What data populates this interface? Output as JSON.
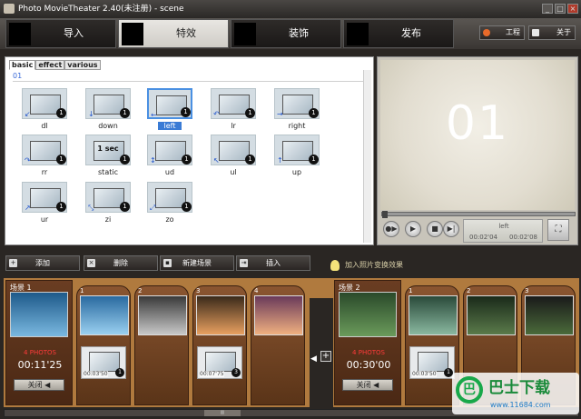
{
  "window": {
    "title": "Photo MovieTheater 2.40(未注册) - scene",
    "minimize": "_",
    "maximize": "□",
    "close": "×"
  },
  "tabs": [
    {
      "label": "导入",
      "active": false
    },
    {
      "label": "特效",
      "active": true
    },
    {
      "label": "装饰",
      "active": false
    },
    {
      "label": "发布",
      "active": false
    }
  ],
  "topbuttons": {
    "project": "工程",
    "about": "关于"
  },
  "effects_panel": {
    "subtabs": [
      "basic",
      "effect",
      "various"
    ],
    "group": "01",
    "items": [
      {
        "label": "dl",
        "badge": "1",
        "arrow": "↙"
      },
      {
        "label": "down",
        "badge": "1",
        "arrow": "↓"
      },
      {
        "label": "left",
        "badge": "1",
        "arrow": "←",
        "selected": true
      },
      {
        "label": "lr",
        "badge": "1",
        "arrow": "↶"
      },
      {
        "label": "right",
        "badge": "1",
        "arrow": "→"
      },
      {
        "label": "rr",
        "badge": "1",
        "arrow": "↷"
      },
      {
        "label": "static",
        "badge": "1",
        "text": "1 sec"
      },
      {
        "label": "ud",
        "badge": "1",
        "arrow": "↕"
      },
      {
        "label": "ul",
        "badge": "1",
        "arrow": "↖"
      },
      {
        "label": "up",
        "badge": "1",
        "arrow": "↑"
      },
      {
        "label": "ur",
        "badge": "1",
        "arrow": "↗"
      },
      {
        "label": "zi",
        "badge": "1",
        "arrow": "⤡"
      },
      {
        "label": "zo",
        "badge": "1",
        "arrow": "⤢"
      }
    ]
  },
  "preview": {
    "number": "01",
    "effect_name": "left",
    "time_current": "00:02'04",
    "time_total": "00:02'08"
  },
  "toolbar": {
    "add": "添加",
    "delete": "删除",
    "new_scene": "新建场景",
    "insert": "插入",
    "hint": "加入照片变换效果"
  },
  "scenes": [
    {
      "label": "场景 1",
      "photos": "4 PHOTOS",
      "time": "00:11'25",
      "close": "关闭 ◀",
      "image_colors": [
        "#1e5a8a",
        "#7ab8e0"
      ]
    },
    {
      "label": "场景 2",
      "photos": "4 PHOTOS",
      "time": "00:30'00",
      "close": "关闭 ◀",
      "image_colors": [
        "#2a4a2a",
        "#6a9a5a"
      ]
    }
  ],
  "slots_scene1": [
    {
      "num": "1",
      "colors": [
        "#2a6aa0",
        "#9ad0f0"
      ],
      "fx_time": "00:03'50",
      "badge": "1"
    },
    {
      "num": "2",
      "colors": [
        "#3a3a3a",
        "#c8c8c8"
      ],
      "fx_time": "",
      "badge": ""
    },
    {
      "num": "3",
      "colors": [
        "#3a2a1a",
        "#e8a060"
      ],
      "fx_time": "00:07'75",
      "badge": "3"
    },
    {
      "num": "4",
      "colors": [
        "#6a3a5a",
        "#f0b080"
      ],
      "fx_time": "",
      "badge": ""
    }
  ],
  "slots_scene2": [
    {
      "num": "1",
      "colors": [
        "#2a4a3a",
        "#8ab8a0"
      ],
      "fx_time": "00:03'50",
      "badge": "1"
    },
    {
      "num": "2",
      "colors": [
        "#1a2a1a",
        "#5a7a4a"
      ],
      "fx_time": "",
      "badge": ""
    },
    {
      "num": "3",
      "colors": [
        "#1a1a1a",
        "#4a6a3a"
      ],
      "fx_time": "",
      "badge": ""
    }
  ],
  "scrollbar": {
    "thumb_glyph": "▥"
  },
  "watermark": {
    "logo": "巴",
    "text": "巴士下载",
    "url": "www.11684.com"
  }
}
